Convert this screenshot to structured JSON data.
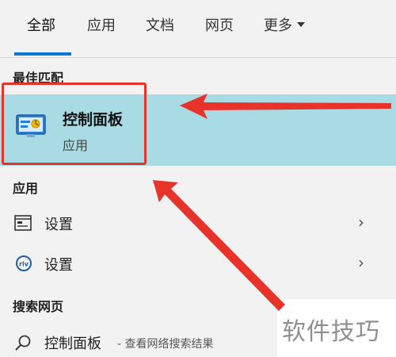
{
  "tabs": [
    {
      "label": "全部",
      "active": true
    },
    {
      "label": "应用",
      "active": false
    },
    {
      "label": "文档",
      "active": false
    },
    {
      "label": "网页",
      "active": false
    },
    {
      "label": "更多",
      "active": false
    }
  ],
  "sections": {
    "best_match": "最佳匹配",
    "apps": "应用",
    "web_search": "搜索网页"
  },
  "best_match": {
    "title": "控制面板",
    "subtitle": "应用",
    "icon": "control-panel-icon"
  },
  "apps": [
    {
      "label": "设置",
      "icon": "settings-window-icon"
    },
    {
      "label": "设置",
      "icon": "settings-gear-icon"
    }
  ],
  "web_search": {
    "query": "控制面板",
    "suffix": "- 查看网络搜索结果",
    "icon": "search-icon"
  },
  "watermark": "软件技巧",
  "colors": {
    "accent": "#0a78d4",
    "highlight": "#a8dbe3",
    "annotation_red": "#e8332a",
    "background": "#f2f2f2"
  }
}
